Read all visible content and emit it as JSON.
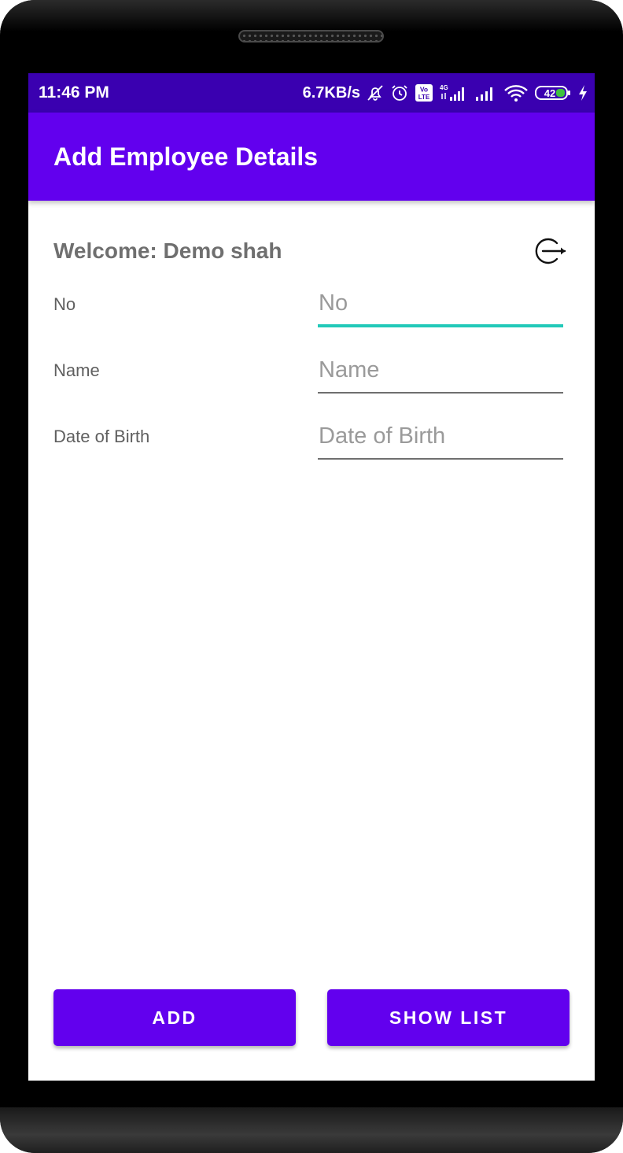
{
  "colors": {
    "status_bar": "#3a00b0",
    "primary": "#6200ee",
    "focus_underline": "#22c9b9"
  },
  "status_bar": {
    "time": "11:46 PM",
    "network_speed": "6.7KB/s",
    "volte_badge": "Vo LTE",
    "network_type": "4G",
    "battery_level": "42",
    "icons": [
      "mute-bell-icon",
      "alarm-icon",
      "volte-icon",
      "signal-4g-icon",
      "signal-icon",
      "wifi-icon",
      "battery-icon",
      "charging-icon"
    ]
  },
  "app_bar": {
    "title": "Add Employee Details"
  },
  "welcome": {
    "text": "Welcome: Demo shah",
    "logout_icon": "logout-icon"
  },
  "form": {
    "fields": [
      {
        "label": "No",
        "placeholder": "No",
        "value": "",
        "focused": true
      },
      {
        "label": "Name",
        "placeholder": "Name",
        "value": "",
        "focused": false
      },
      {
        "label": "Date of Birth",
        "placeholder": "Date of Birth",
        "value": "",
        "focused": false
      }
    ]
  },
  "buttons": {
    "add_label": "ADD",
    "show_list_label": "SHOW LIST"
  }
}
